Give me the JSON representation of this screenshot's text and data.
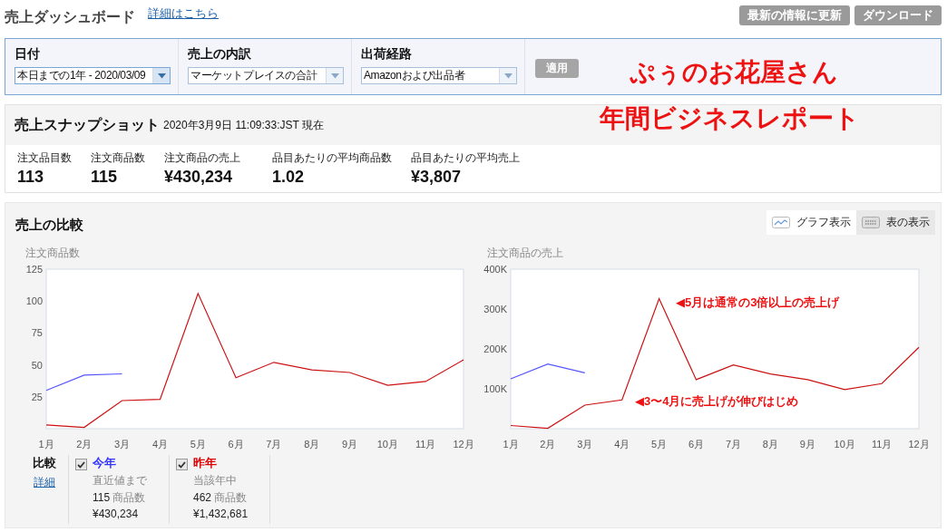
{
  "header": {
    "title": "売上ダッシュボード",
    "link": "詳細はこちら",
    "buttons": [
      "最新の情報に更新",
      "ダウンロード"
    ]
  },
  "filters": [
    {
      "label": "日付",
      "value": "本日までの1年 - 2020/03/09",
      "selected": true
    },
    {
      "label": "売上の内訳",
      "value": "マーケットプレイスの合計",
      "selected": false
    },
    {
      "label": "出荷経路",
      "value": "Amazonおよび出品者",
      "selected": false
    }
  ],
  "apply_button": {
    "label": "適用",
    "disabled": true
  },
  "overlay_titles": [
    "ぷぅのお花屋さん",
    "年間ビジネスレポート"
  ],
  "snapshot": {
    "title": "売上スナップショット",
    "timestamp": "2020年3月9日 11:09:33:JST 現在",
    "metrics": [
      {
        "label": "注文品目数",
        "value": "113"
      },
      {
        "label": "注文商品数",
        "value": "115"
      },
      {
        "label": "注文商品の売上",
        "value": "¥430,234"
      },
      {
        "label": "品目あたりの平均商品数",
        "value": "1.02"
      },
      {
        "label": "品目あたりの平均売上",
        "value": "¥3,807"
      }
    ]
  },
  "comparison": {
    "title": "売上の比較",
    "view_toggle": [
      {
        "kind": "graph",
        "label": "グラフ表示",
        "selected": true
      },
      {
        "kind": "table",
        "label": "表の表示",
        "selected": false
      }
    ],
    "charts": [
      {
        "chart_data": {
          "type": "line",
          "ylabel": "注文商品数",
          "categories": [
            "1月",
            "2月",
            "3月",
            "4月",
            "5月",
            "6月",
            "7月",
            "8月",
            "9月",
            "10月",
            "11月",
            "12月"
          ],
          "ylim": [
            0,
            125
          ],
          "yticks": [
            25,
            50,
            75,
            100,
            125
          ],
          "series": [
            {
              "color": "#5555ff",
              "values": [
                30,
                42,
                43,
                null,
                null,
                null,
                null,
                null,
                null,
                null,
                null,
                null
              ]
            },
            {
              "color": "#cc1111",
              "values": [
                3,
                1,
                22,
                23,
                106,
                40,
                52,
                46,
                44,
                34,
                37,
                54
              ]
            }
          ]
        }
      },
      {
        "chart_data": {
          "type": "line",
          "ylabel": "注文商品の売上",
          "categories": [
            "1月",
            "2月",
            "3月",
            "4月",
            "5月",
            "6月",
            "7月",
            "8月",
            "9月",
            "10月",
            "11月",
            "12月"
          ],
          "ylim": [
            0,
            400000
          ],
          "yticks": [
            {
              "value": 100000,
              "label": "100K"
            },
            {
              "value": 200000,
              "label": "200K"
            },
            {
              "value": 300000,
              "label": "300K"
            },
            {
              "value": 400000,
              "label": "400K"
            }
          ],
          "series": [
            {
              "color": "#5555ff",
              "values": [
                125000,
                162000,
                140000,
                null,
                null,
                null,
                null,
                null,
                null,
                null,
                null,
                null
              ]
            },
            {
              "color": "#cc1111",
              "values": [
                8000,
                1000,
                59000,
                72000,
                326000,
                123000,
                160000,
                137000,
                123000,
                98000,
                113000,
                204000
              ]
            }
          ],
          "annotations": [
            "◀5月は通常の3倍以上の売上げ",
            "◀3〜4月に売上げが伸びはじめ"
          ]
        }
      }
    ],
    "legend": {
      "label": "比較",
      "link": "詳細",
      "series": [
        {
          "name": "今年",
          "color": "#3333ff",
          "checked": true,
          "note": "直近値まで",
          "count": "115",
          "unit": "商品数",
          "amount": "¥430,234"
        },
        {
          "name": "昨年",
          "color": "#dd0000",
          "checked": true,
          "note": "当該年中",
          "count": "462",
          "unit": "商品数",
          "amount": "¥1,432,681"
        }
      ]
    }
  }
}
